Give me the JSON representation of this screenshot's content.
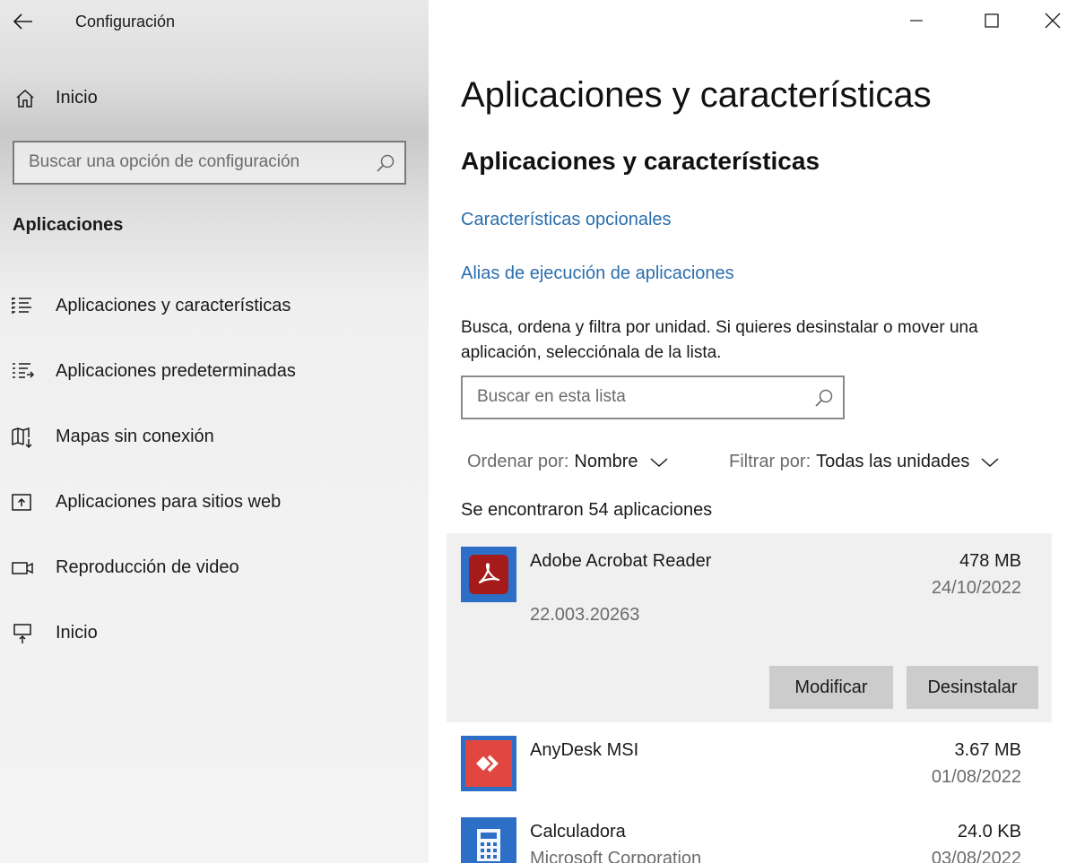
{
  "window": {
    "app_title": "Configuración"
  },
  "sidebar": {
    "home_label": "Inicio",
    "search_placeholder": "Buscar una opción de configuración",
    "section_title": "Aplicaciones",
    "items": [
      {
        "label": "Aplicaciones y características",
        "icon": "apps-features-icon"
      },
      {
        "label": "Aplicaciones predeterminadas",
        "icon": "default-apps-icon"
      },
      {
        "label": "Mapas sin conexión",
        "icon": "offline-maps-icon"
      },
      {
        "label": "Aplicaciones para sitios web",
        "icon": "apps-for-websites-icon"
      },
      {
        "label": "Reproducción de video",
        "icon": "video-playback-icon"
      },
      {
        "label": "Inicio",
        "icon": "startup-icon"
      }
    ]
  },
  "main": {
    "page_title": "Aplicaciones y características",
    "sub_title": "Aplicaciones y características",
    "links": {
      "optional_features": "Características opcionales",
      "app_aliases": "Alias de ejecución de aplicaciones"
    },
    "description": "Busca, ordena y filtra por unidad. Si quieres desinstalar o mover una aplicación, selecciónala de la lista.",
    "list_search_placeholder": "Buscar en esta lista",
    "sort": {
      "label": "Ordenar por:",
      "value": "Nombre"
    },
    "filter": {
      "label": "Filtrar por:",
      "value": "Todas las unidades"
    },
    "count_text": "Se encontraron 54 aplicaciones",
    "apps": [
      {
        "name": "Adobe Acrobat Reader",
        "size": "478 MB",
        "date": "24/10/2022",
        "version": "22.003.20263",
        "icon": "adobe-acrobat-icon",
        "selected": true
      },
      {
        "name": "AnyDesk MSI",
        "size": "3.67 MB",
        "date": "01/08/2022",
        "icon": "anydesk-icon"
      },
      {
        "name": "Calculadora",
        "publisher": "Microsoft Corporation",
        "size": "24.0 KB",
        "date": "03/08/2022",
        "icon": "calculator-icon"
      }
    ],
    "buttons": {
      "modify": "Modificar",
      "uninstall": "Desinstalar"
    }
  },
  "colors": {
    "link": "#2a6eaf",
    "accent_tile": "#2d6fc6",
    "acrobat_red": "#a51b1b",
    "anydesk_red": "#e2473f"
  }
}
